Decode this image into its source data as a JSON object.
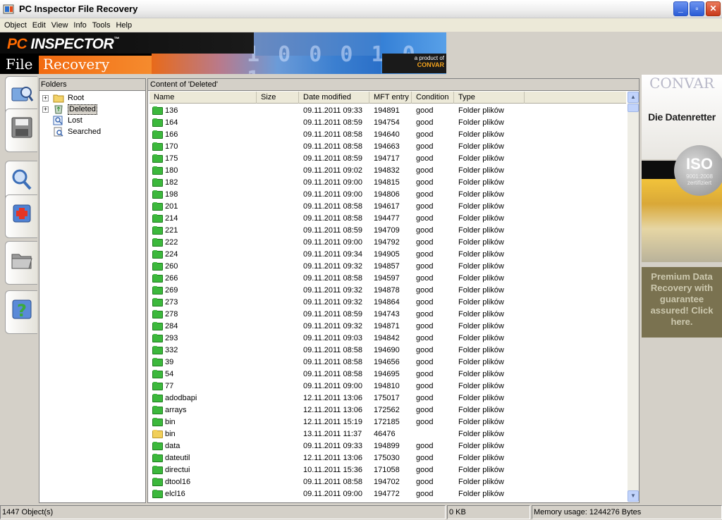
{
  "window": {
    "title": "PC Inspector File Recovery"
  },
  "menu": [
    {
      "label": "Object"
    },
    {
      "label": "Edit"
    },
    {
      "label": "View"
    },
    {
      "label": "Info"
    },
    {
      "label": "Tools"
    },
    {
      "label": "Help"
    }
  ],
  "banner": {
    "brand_pc": "PC",
    "brand_inspector": " INSPECTOR",
    "tm": "™",
    "word_file": "File",
    "word_recovery": "Recovery",
    "digits": "1 0 0 0 1 0 1",
    "product_of": "a product of",
    "convar": "CONVAR"
  },
  "tree": {
    "header": "Folders",
    "items": [
      {
        "label": "Root",
        "icon": "folder-icon",
        "expandable": true,
        "selected": false
      },
      {
        "label": "Deleted",
        "icon": "recycle-bin-icon",
        "expandable": true,
        "selected": true
      },
      {
        "label": "Lost",
        "icon": "magnifier-icon",
        "expandable": false,
        "selected": false
      },
      {
        "label": "Searched",
        "icon": "search-doc-icon",
        "expandable": false,
        "selected": false
      }
    ]
  },
  "content": {
    "header": "Content of 'Deleted'",
    "columns": [
      "Name",
      "Size",
      "Date modified",
      "MFT entry",
      "Condition",
      "Type"
    ],
    "rows": [
      {
        "name": "136",
        "date": "09.11.2011 09:33",
        "mft": "194891",
        "condition": "good",
        "type": "Folder plików",
        "color": "green"
      },
      {
        "name": "164",
        "date": "09.11.2011 08:59",
        "mft": "194754",
        "condition": "good",
        "type": "Folder plików",
        "color": "green"
      },
      {
        "name": "166",
        "date": "09.11.2011 08:58",
        "mft": "194640",
        "condition": "good",
        "type": "Folder plików",
        "color": "green"
      },
      {
        "name": "170",
        "date": "09.11.2011 08:58",
        "mft": "194663",
        "condition": "good",
        "type": "Folder plików",
        "color": "green"
      },
      {
        "name": "175",
        "date": "09.11.2011 08:59",
        "mft": "194717",
        "condition": "good",
        "type": "Folder plików",
        "color": "green"
      },
      {
        "name": "180",
        "date": "09.11.2011 09:02",
        "mft": "194832",
        "condition": "good",
        "type": "Folder plików",
        "color": "green"
      },
      {
        "name": "182",
        "date": "09.11.2011 09:00",
        "mft": "194815",
        "condition": "good",
        "type": "Folder plików",
        "color": "green"
      },
      {
        "name": "198",
        "date": "09.11.2011 09:00",
        "mft": "194806",
        "condition": "good",
        "type": "Folder plików",
        "color": "green"
      },
      {
        "name": "201",
        "date": "09.11.2011 08:58",
        "mft": "194617",
        "condition": "good",
        "type": "Folder plików",
        "color": "green"
      },
      {
        "name": "214",
        "date": "09.11.2011 08:58",
        "mft": "194477",
        "condition": "good",
        "type": "Folder plików",
        "color": "green"
      },
      {
        "name": "221",
        "date": "09.11.2011 08:59",
        "mft": "194709",
        "condition": "good",
        "type": "Folder plików",
        "color": "green"
      },
      {
        "name": "222",
        "date": "09.11.2011 09:00",
        "mft": "194792",
        "condition": "good",
        "type": "Folder plików",
        "color": "green"
      },
      {
        "name": "224",
        "date": "09.11.2011 09:34",
        "mft": "194905",
        "condition": "good",
        "type": "Folder plików",
        "color": "green"
      },
      {
        "name": "260",
        "date": "09.11.2011 09:32",
        "mft": "194857",
        "condition": "good",
        "type": "Folder plików",
        "color": "green"
      },
      {
        "name": "266",
        "date": "09.11.2011 08:58",
        "mft": "194597",
        "condition": "good",
        "type": "Folder plików",
        "color": "green"
      },
      {
        "name": "269",
        "date": "09.11.2011 09:32",
        "mft": "194878",
        "condition": "good",
        "type": "Folder plików",
        "color": "green"
      },
      {
        "name": "273",
        "date": "09.11.2011 09:32",
        "mft": "194864",
        "condition": "good",
        "type": "Folder plików",
        "color": "green"
      },
      {
        "name": "278",
        "date": "09.11.2011 08:59",
        "mft": "194743",
        "condition": "good",
        "type": "Folder plików",
        "color": "green"
      },
      {
        "name": "284",
        "date": "09.11.2011 09:32",
        "mft": "194871",
        "condition": "good",
        "type": "Folder plików",
        "color": "green"
      },
      {
        "name": "293",
        "date": "09.11.2011 09:03",
        "mft": "194842",
        "condition": "good",
        "type": "Folder plików",
        "color": "green"
      },
      {
        "name": "332",
        "date": "09.11.2011 08:58",
        "mft": "194690",
        "condition": "good",
        "type": "Folder plików",
        "color": "green"
      },
      {
        "name": "39",
        "date": "09.11.2011 08:58",
        "mft": "194656",
        "condition": "good",
        "type": "Folder plików",
        "color": "green"
      },
      {
        "name": "54",
        "date": "09.11.2011 08:58",
        "mft": "194695",
        "condition": "good",
        "type": "Folder plików",
        "color": "green"
      },
      {
        "name": "77",
        "date": "09.11.2011 09:00",
        "mft": "194810",
        "condition": "good",
        "type": "Folder plików",
        "color": "green"
      },
      {
        "name": "adodbapi",
        "date": "12.11.2011 13:06",
        "mft": "175017",
        "condition": "good",
        "type": "Folder plików",
        "color": "green"
      },
      {
        "name": "arrays",
        "date": "12.11.2011 13:06",
        "mft": "172562",
        "condition": "good",
        "type": "Folder plików",
        "color": "green"
      },
      {
        "name": "bin",
        "date": "12.11.2011 15:19",
        "mft": "172185",
        "condition": "good",
        "type": "Folder plików",
        "color": "green"
      },
      {
        "name": "bin",
        "date": "13.11.2011 11:37",
        "mft": "46476",
        "condition": "",
        "type": "Folder plików",
        "color": "yellow"
      },
      {
        "name": "data",
        "date": "09.11.2011 09:33",
        "mft": "194899",
        "condition": "good",
        "type": "Folder plików",
        "color": "green"
      },
      {
        "name": "dateutil",
        "date": "12.11.2011 13:06",
        "mft": "175030",
        "condition": "good",
        "type": "Folder plików",
        "color": "green"
      },
      {
        "name": "directui",
        "date": "10.11.2011 15:36",
        "mft": "171058",
        "condition": "good",
        "type": "Folder plików",
        "color": "green"
      },
      {
        "name": "dtool16",
        "date": "09.11.2011 08:58",
        "mft": "194702",
        "condition": "good",
        "type": "Folder plików",
        "color": "green"
      },
      {
        "name": "elcl16",
        "date": "09.11.2011 09:00",
        "mft": "194772",
        "condition": "good",
        "type": "Folder plików",
        "color": "green"
      }
    ]
  },
  "ad": {
    "convar": "CONVAR",
    "datenretter": "Die Datenretter",
    "iso": "ISO",
    "iso_sub": "9001:2008 zertifiziert",
    "premium": "Premium Data Recovery with guarantee assured! Click here."
  },
  "status": {
    "objects": "1447 Object(s)",
    "size": "0 KB",
    "memory": "Memory usage: 1244276 Bytes"
  },
  "colors": {
    "folder_green": "#3cb83c",
    "folder_yellow": "#f1cf5a",
    "titlebar": "#ececec"
  }
}
